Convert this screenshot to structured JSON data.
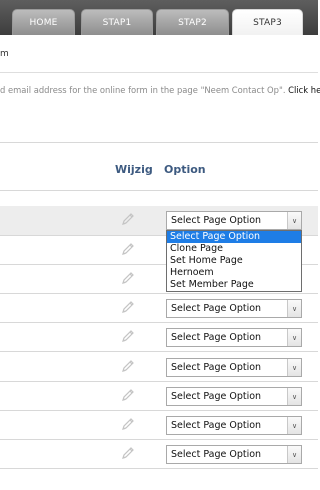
{
  "tabs": [
    {
      "label": "HOME"
    },
    {
      "label": "STAP1"
    },
    {
      "label": "STAP2"
    },
    {
      "label": "STAP3"
    }
  ],
  "subheader": {
    "text": "m"
  },
  "info": {
    "text": "d email address for the online form in the page \"Neem Contact Op\". ",
    "link": "Click he"
  },
  "columns": {
    "wijzig": "Wijzig",
    "option": "Option"
  },
  "select_value": "Select Page Option",
  "dropdown_options": [
    "Select Page Option",
    "Clone Page",
    "Set Home Page",
    "Hernoem",
    "Set Member Page"
  ],
  "colors": {
    "header_text": "#3d5a80",
    "selected_option": "#1e7de6"
  }
}
